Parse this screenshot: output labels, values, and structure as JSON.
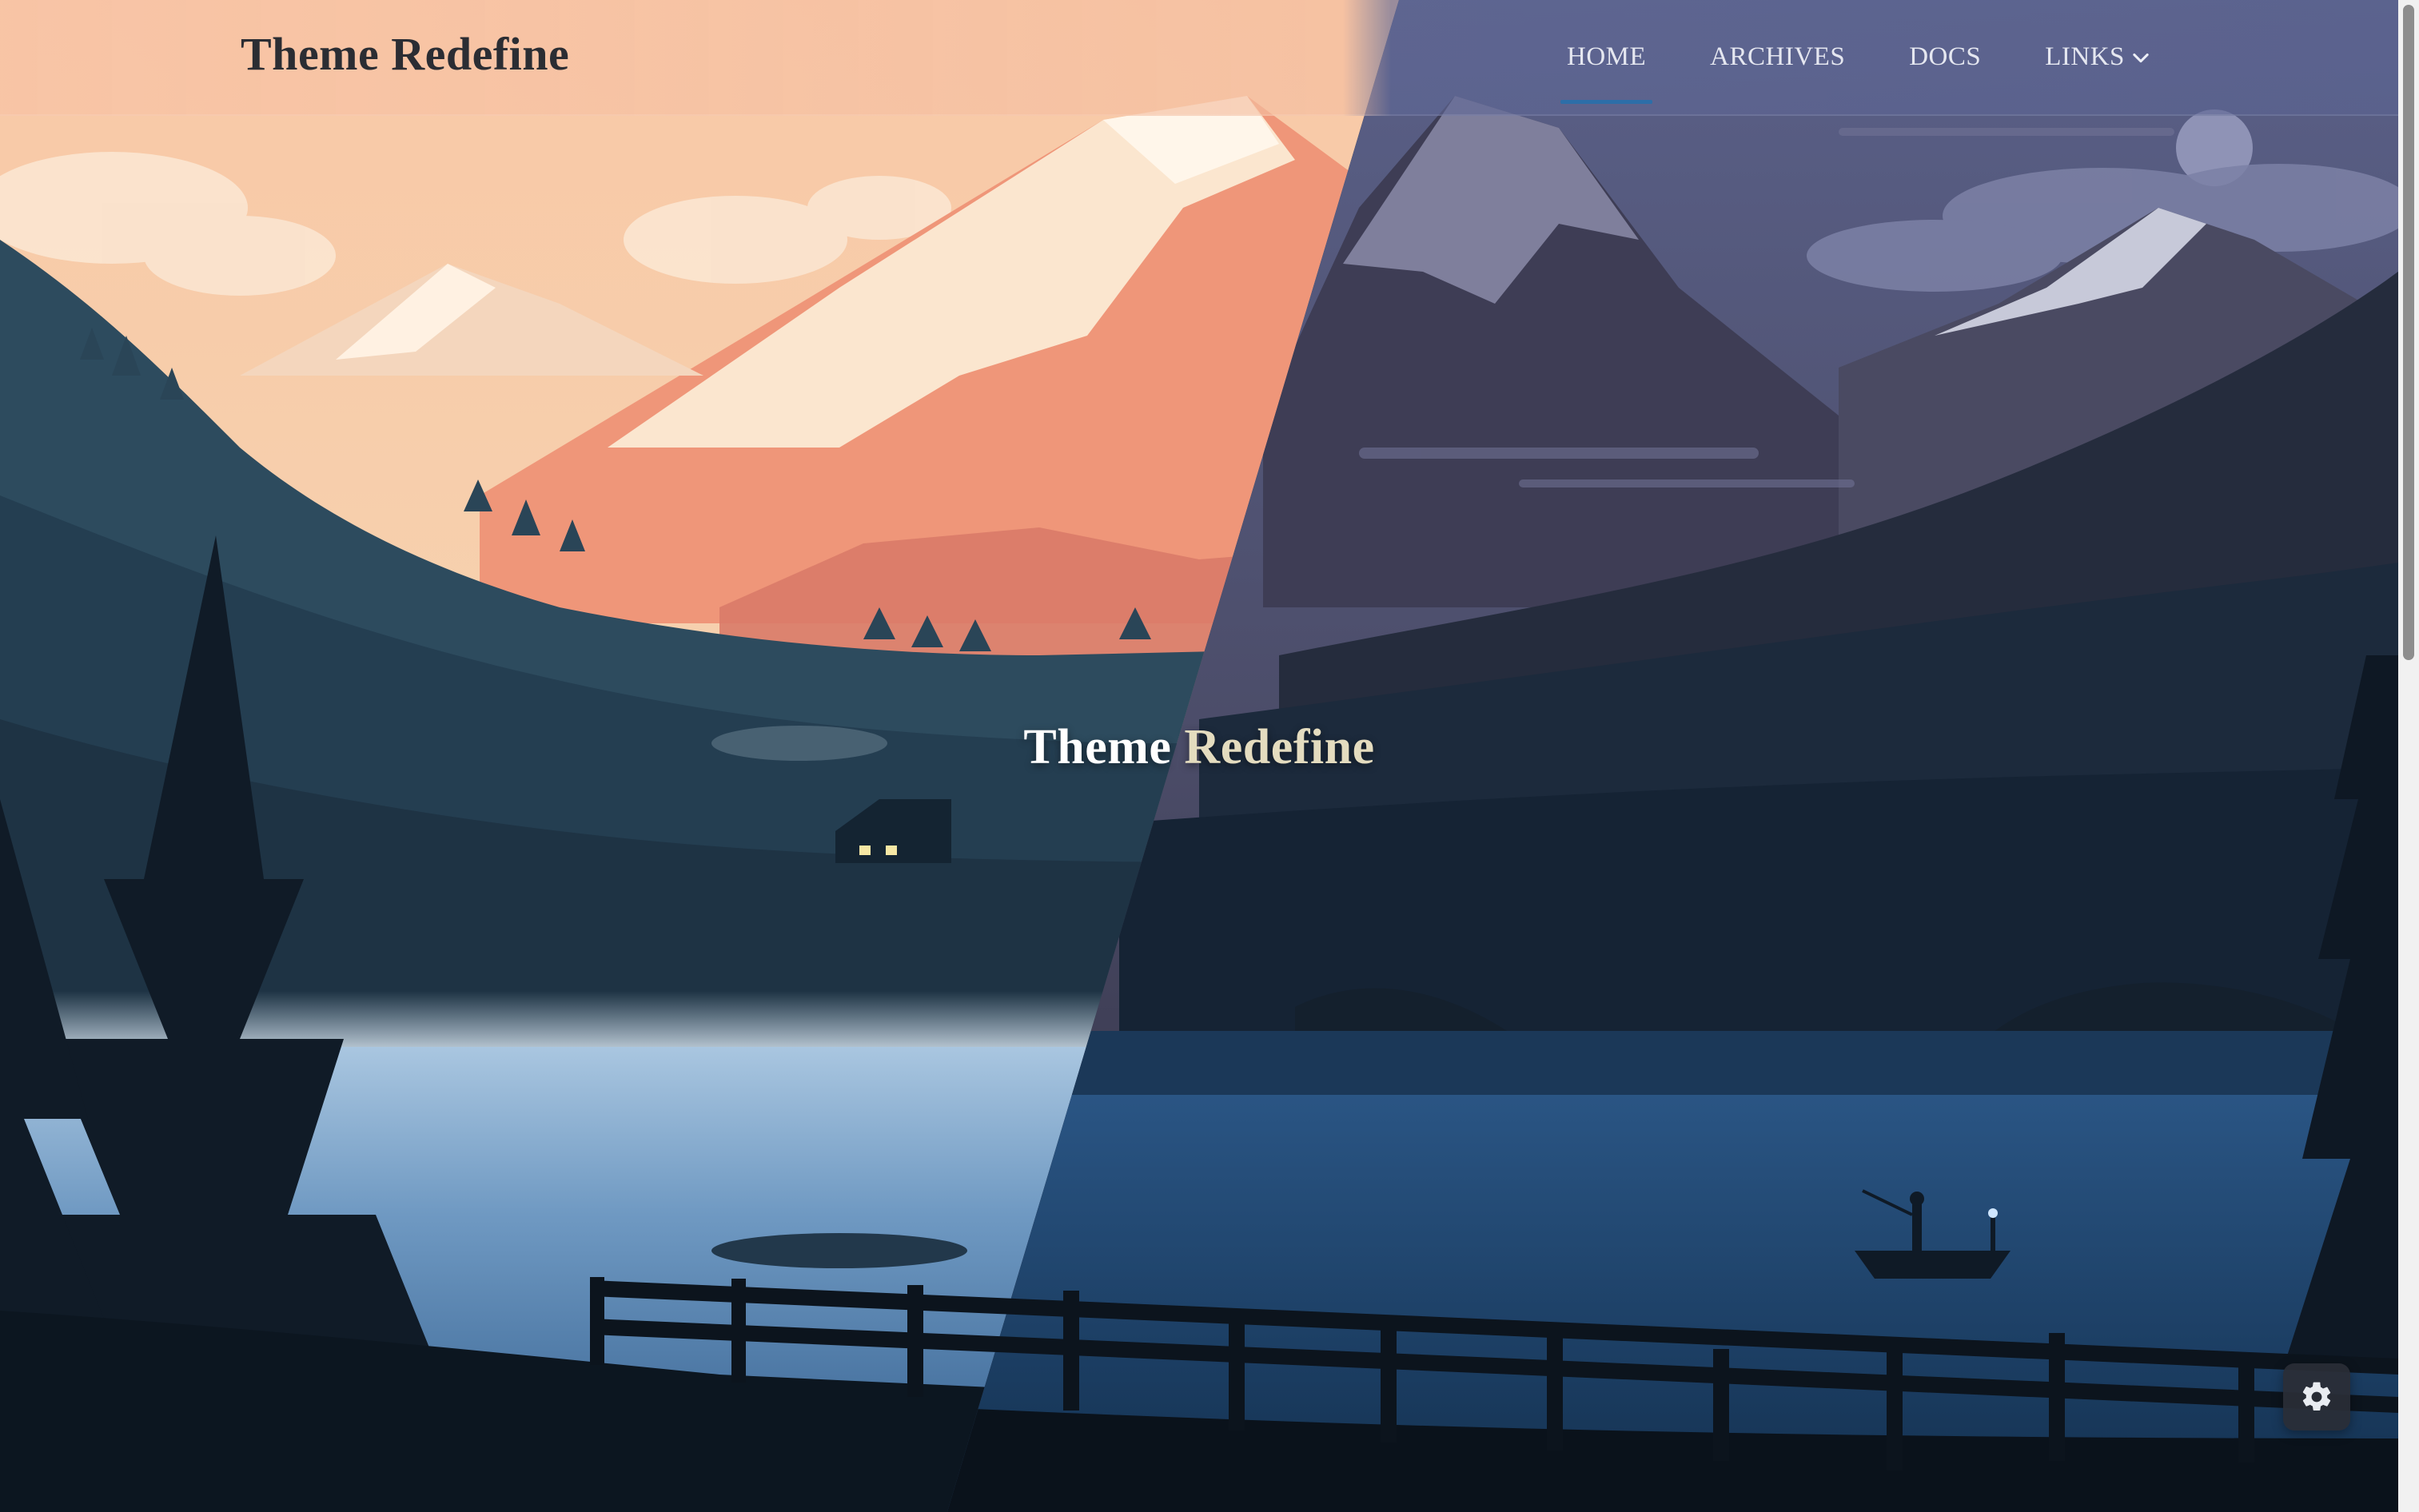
{
  "site": {
    "brand": "Theme Redefine"
  },
  "nav": {
    "items": [
      {
        "label": "HOME",
        "active": true
      },
      {
        "label": "ARCHIVES",
        "active": false
      },
      {
        "label": "DOCS",
        "active": false
      },
      {
        "label": "LINKS",
        "active": false,
        "has_dropdown": true
      }
    ]
  },
  "hero": {
    "title_word1": "Theme",
    "title_word2": "Redefine"
  },
  "colors": {
    "accent": "#2d6ea8",
    "title_secondary": "#e4dcbf",
    "sunset_sky": "#f6c6a3",
    "night_sky": "#5b5f7e",
    "lake": "#2f5a86"
  },
  "icons": {
    "settings": "gear-icon",
    "dropdown": "chevron-down-icon"
  }
}
